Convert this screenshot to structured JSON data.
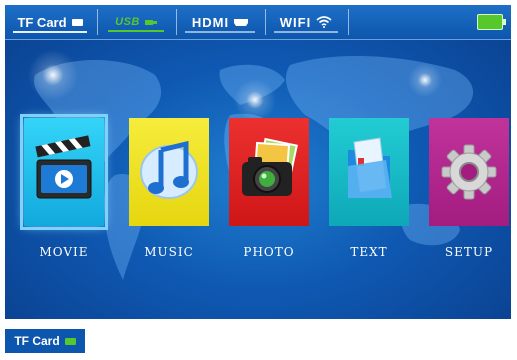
{
  "status_bar": {
    "tabs": [
      {
        "label": "TF Card",
        "icon": "sd-card-icon",
        "active": true
      },
      {
        "label": "USB",
        "icon": "usb-plug-icon",
        "active": false
      },
      {
        "label": "HDMI",
        "icon": "hdmi-connector-icon",
        "active": false
      },
      {
        "label": "WIFI",
        "icon": "wifi-icon",
        "active": false
      }
    ],
    "battery": {
      "icon": "battery-icon",
      "level": 1.0,
      "color": "#57c72e"
    }
  },
  "menu": {
    "items": [
      {
        "label": "MOVIE",
        "icon": "clapperboard-icon",
        "color": "#1ec3ef",
        "selected": true
      },
      {
        "label": "MUSIC",
        "icon": "music-note-icon",
        "color": "#f1e51c",
        "selected": false
      },
      {
        "label": "PHOTO",
        "icon": "camera-icon",
        "color": "#e02323",
        "selected": false
      },
      {
        "label": "TEXT",
        "icon": "document-folder-icon",
        "color": "#16c0c8",
        "selected": false
      },
      {
        "label": "SETUP",
        "icon": "gear-icon",
        "color": "#b4278f",
        "selected": false
      }
    ]
  },
  "source_badge": {
    "label": "TF Card",
    "icon": "sd-card-icon"
  }
}
